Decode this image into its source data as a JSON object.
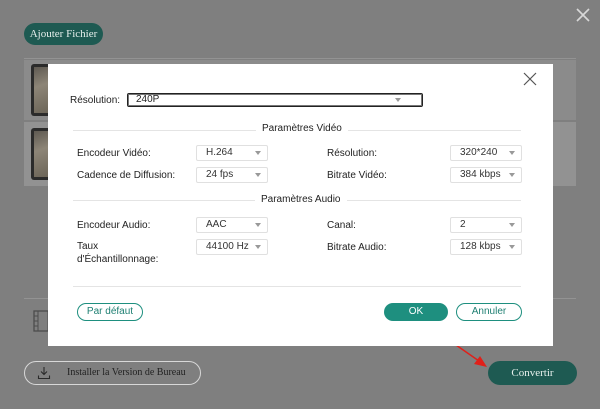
{
  "background": {
    "add_file_label": "Ajouter Fichier",
    "install_label": "Installer la Version de Bureau",
    "convert_label": "Convertir"
  },
  "modal": {
    "top_resolution_label": "Résolution:",
    "top_resolution_value": "240P",
    "video_section_title": "Paramètres Vidéo",
    "audio_section_title": "Paramètres Audio",
    "video": {
      "encoder_label": "Encodeur Vidéo:",
      "encoder_value": "H.264",
      "resolution_label": "Résolution:",
      "resolution_value": "320*240",
      "framerate_label": "Cadence de Diffusion:",
      "framerate_value": "24 fps",
      "bitrate_label": "Bitrate Vidéo:",
      "bitrate_value": "384 kbps"
    },
    "audio": {
      "encoder_label": "Encodeur Audio:",
      "encoder_value": "AAC",
      "channel_label": "Canal:",
      "channel_value": "2",
      "samplerate_label": "Taux d'Échantillonnage:",
      "samplerate_value": "44100 Hz",
      "bitrate_label": "Bitrate Audio:",
      "bitrate_value": "128 kbps"
    },
    "default_label": "Par défaut",
    "ok_label": "OK",
    "cancel_label": "Annuler"
  },
  "colors": {
    "accent": "#1e8f7f",
    "accent_dark": "#1e5a52",
    "arrow": "#e0201a"
  },
  "icons": {
    "bg_close": "close-icon",
    "modal_close": "close-icon",
    "film": "film-icon",
    "download": "download-icon",
    "caret": "caret-down-icon"
  }
}
